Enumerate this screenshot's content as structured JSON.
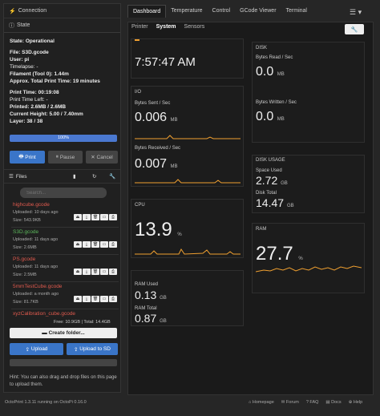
{
  "sidebar": {
    "connection_title": "Connection",
    "state_title": "State",
    "state": {
      "state": "State: Operational",
      "file": "File: S3D.gcode",
      "user": "User: pi",
      "timelapse": "Timelapse: -",
      "filament": "Filament (Tool 0): 1.44m",
      "approx_total": "Approx. Total Print Time: 19 minutes",
      "print_time": "Print Time: 00:19:08",
      "print_time_left": "Print Time Left: -",
      "printed": "Printed: 2.6MB / 2.6MB",
      "current_height": "Current Height: 5.00 / 7.40mm",
      "layer": "Layer: 38 / 38"
    },
    "progress": {
      "value": 1.0,
      "label": "100%"
    },
    "buttons": {
      "print": "Print",
      "pause": "Pause",
      "cancel": "Cancel"
    },
    "files_title": "Files",
    "search_placeholder": "Search...",
    "files": [
      {
        "name": "highcube.gcode",
        "uploaded": "Uploaded: 10 days ago",
        "size": "Size: 543.9KB",
        "color": "#e05a4e"
      },
      {
        "name": "S3D.gcode",
        "uploaded": "Uploaded: 11 days ago",
        "size": "Size: 2.6MB",
        "color": "#5cb85c"
      },
      {
        "name": "PS.gcode",
        "uploaded": "Uploaded: 11 days ago",
        "size": "Size: 2.5MB",
        "color": "#e05a4e"
      },
      {
        "name": "5mmTestCube.gcode",
        "uploaded": "Uploaded: a month ago",
        "size": "Size: 81.7KB",
        "color": "#e05a4e"
      },
      {
        "name": "xyzCalibration_cube.gcode",
        "uploaded": "",
        "size": "",
        "color": "#e05a4e"
      }
    ],
    "free_text": "Free: 10.9GB | Total: 14.4GB",
    "create_folder": "Create folder...",
    "upload": "Upload",
    "upload_sd": "Upload to SD",
    "hint": "Hint: You can also drag and drop files on this page to upload them."
  },
  "tabs": [
    "Dashboard",
    "Temperature",
    "Control",
    "GCode Viewer",
    "Terminal"
  ],
  "subtabs": [
    "Printer",
    "System",
    "Sensors"
  ],
  "system": {
    "clock": "7:57:47 AM",
    "io": {
      "title": "I/O",
      "sent_label": "Bytes Sent / Sec",
      "sent_value": "0.006",
      "sent_unit": "MB",
      "recv_label": "Bytes Received / Sec",
      "recv_value": "0.007",
      "recv_unit": "MB"
    },
    "disk": {
      "title": "DISK",
      "read_label": "Bytes Read / Sec",
      "read_value": "0.0",
      "read_unit": "MB",
      "write_label": "Bytes Written / Sec",
      "write_value": "0.0",
      "write_unit": "MB"
    },
    "cpu": {
      "title": "CPU",
      "value": "13.9",
      "unit": "%"
    },
    "disk_usage": {
      "title": "DISK USAGE",
      "space_used_label": "Space Used",
      "space_used_value": "2.72",
      "space_used_unit": "GB",
      "disk_total_label": "Disk Total",
      "disk_total_value": "14.47",
      "disk_total_unit": "GB"
    },
    "ram": {
      "title": "RAM",
      "value": "27.7",
      "unit": "%"
    },
    "ram_detail": {
      "used_label": "RAM Used",
      "used_value": "0.13",
      "used_unit": "GB",
      "total_label": "RAM Total",
      "total_value": "0.87",
      "total_unit": "GB"
    }
  },
  "footer": {
    "version": "OctoPrint 1.3.11 running on OctoPi 0.16.0",
    "homepage": "Homepage",
    "forum": "Forum",
    "faq": "FAQ",
    "docs": "Docs",
    "help": "Help"
  },
  "colors": {
    "accent": "#f0a030",
    "blue": "#3a75c8",
    "progress": "#4a78d0"
  }
}
